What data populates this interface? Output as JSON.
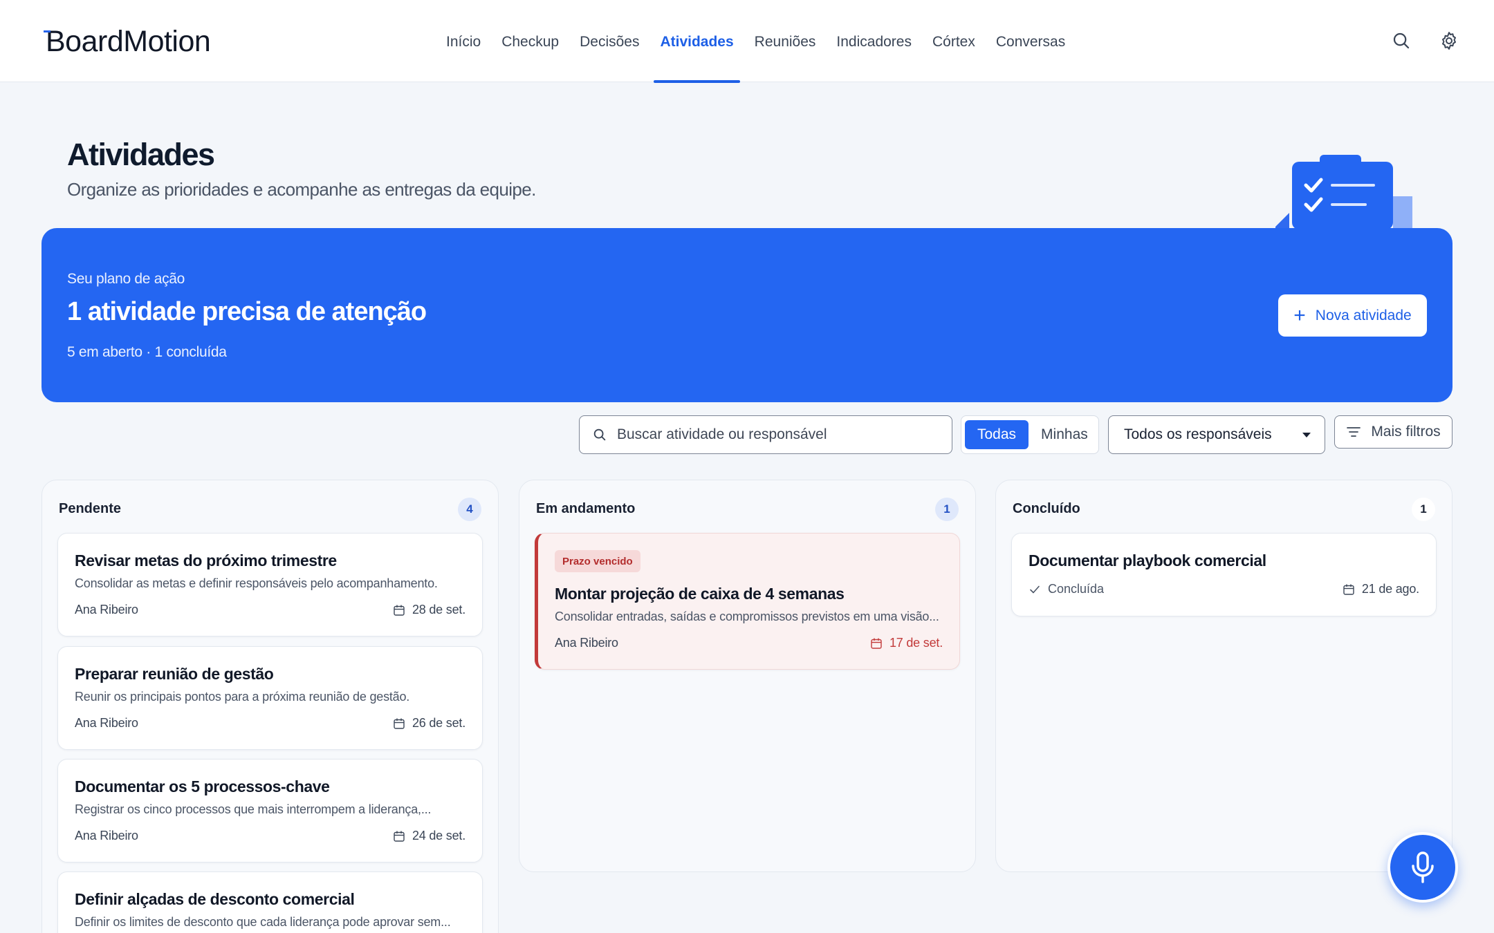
{
  "app": {
    "logo_text": "BoardMotion"
  },
  "nav": {
    "items": [
      {
        "label": "Início",
        "active": false
      },
      {
        "label": "Checkup",
        "active": false
      },
      {
        "label": "Decisões",
        "active": false
      },
      {
        "label": "Atividades",
        "active": true
      },
      {
        "label": "Reuniões",
        "active": false
      },
      {
        "label": "Indicadores",
        "active": false
      },
      {
        "label": "Córtex",
        "active": false
      },
      {
        "label": "Conversas",
        "active": false
      }
    ]
  },
  "page": {
    "title": "Atividades",
    "subtitle": "Organize as prioridades e acompanhe as entregas da equipe."
  },
  "banner": {
    "kicker": "Seu plano de ação",
    "title": "1 atividade precisa de atenção",
    "meta": "5 em aberto · 1 concluída",
    "new_button": "Nova atividade"
  },
  "filters": {
    "search_placeholder": "Buscar atividade ou responsável",
    "segment_all": "Todas",
    "segment_mine": "Minhas",
    "assignee_select": "Todos os responsáveis",
    "more_filters": "Mais filtros"
  },
  "columns": {
    "pending": {
      "title": "Pendente",
      "count": "4",
      "cards": [
        {
          "title": "Revisar metas do próximo trimestre",
          "desc": "Consolidar as metas e definir responsáveis pelo acompanhamento.",
          "owner": "Ana Ribeiro",
          "date": "28 de set."
        },
        {
          "title": "Preparar reunião de gestão",
          "desc": "Reunir os principais pontos para a próxima reunião de gestão.",
          "owner": "Ana Ribeiro",
          "date": "26 de set."
        },
        {
          "title": "Documentar os 5 processos-chave",
          "desc": "Registrar os cinco processos que mais interrompem a liderança,...",
          "owner": "Ana Ribeiro",
          "date": "24 de set."
        },
        {
          "title": "Definir alçadas de desconto comercial",
          "desc": "Definir os limites de desconto que cada liderança pode aprovar sem..."
        }
      ]
    },
    "in_progress": {
      "title": "Em andamento",
      "count": "1",
      "cards": [
        {
          "badge": "Prazo vencido",
          "title": "Montar projeção de caixa de 4 semanas",
          "desc": "Consolidar entradas, saídas e compromissos previstos em uma visão...",
          "owner": "Ana Ribeiro",
          "date": "17 de set."
        }
      ]
    },
    "done": {
      "title": "Concluído",
      "count": "1",
      "cards": [
        {
          "title": "Documentar playbook comercial",
          "status": "Concluída",
          "date": "21 de ago."
        }
      ]
    }
  },
  "colors": {
    "accent": "#2466f2",
    "overdue": "#c23a3a",
    "background": "#f3f6fa"
  },
  "icons": [
    "search-icon",
    "gear-icon",
    "plus-icon",
    "filter-icon",
    "chevron-down-icon",
    "calendar-icon",
    "check-icon",
    "microphone-icon",
    "clipboard-illustration"
  ]
}
